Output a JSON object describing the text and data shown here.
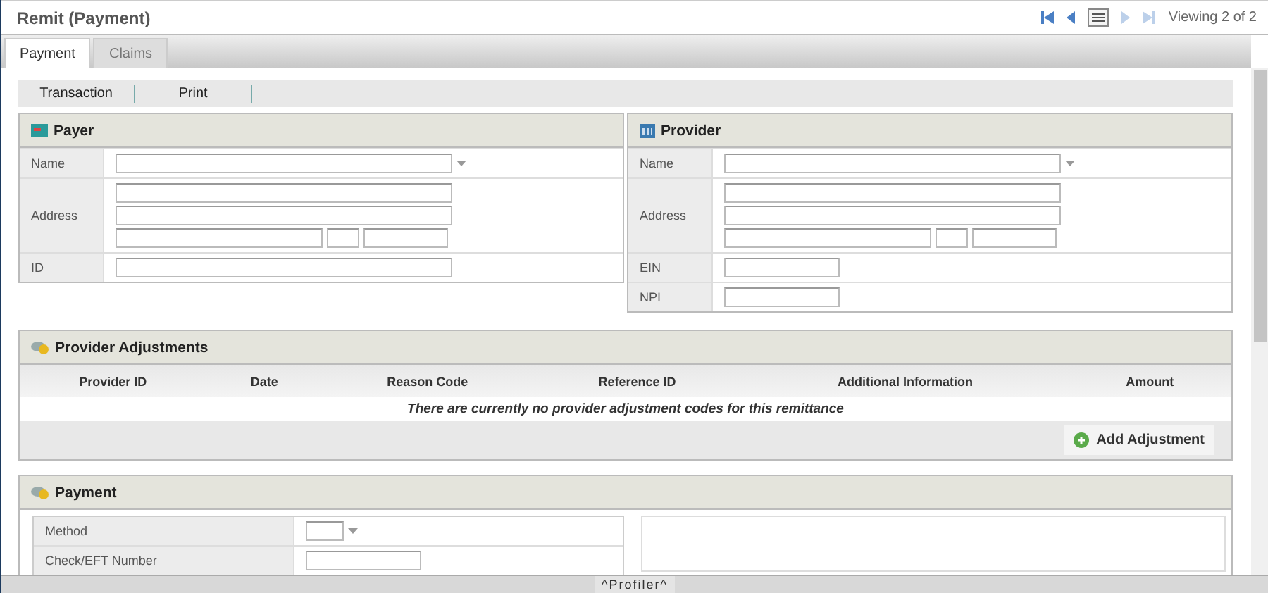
{
  "window": {
    "title": "Remit (Payment)"
  },
  "pager": {
    "status": "Viewing 2 of 2"
  },
  "tabs": [
    {
      "label": "Payment",
      "selected": true
    },
    {
      "label": "Claims",
      "selected": false
    }
  ],
  "toolbar": [
    "Transaction",
    "Print"
  ],
  "panels": [
    {
      "title": "Payer",
      "fields": [
        {
          "label": "Name",
          "kind": "select"
        },
        {
          "label": "Address",
          "kind": "address"
        },
        {
          "label": "ID",
          "kind": "text"
        }
      ]
    },
    {
      "title": "Provider",
      "fields": [
        {
          "label": "Name",
          "kind": "select"
        },
        {
          "label": "Address",
          "kind": "address"
        },
        {
          "label": "EIN",
          "kind": "short"
        },
        {
          "label": "NPI",
          "kind": "short"
        }
      ]
    }
  ],
  "adjustments": {
    "title": "Provider Adjustments",
    "columns": [
      "Provider ID",
      "Date",
      "Reason Code",
      "Reference ID",
      "Additional Information",
      "Amount"
    ],
    "empty_message": "There are currently no provider adjustment codes for this remittance",
    "add_button": "Add Adjustment"
  },
  "payment": {
    "title": "Payment",
    "fields": [
      {
        "label": "Method",
        "kind": "tiny-select"
      },
      {
        "label": "Check/EFT Number",
        "kind": "short"
      }
    ]
  },
  "profiler": "^Profiler^"
}
